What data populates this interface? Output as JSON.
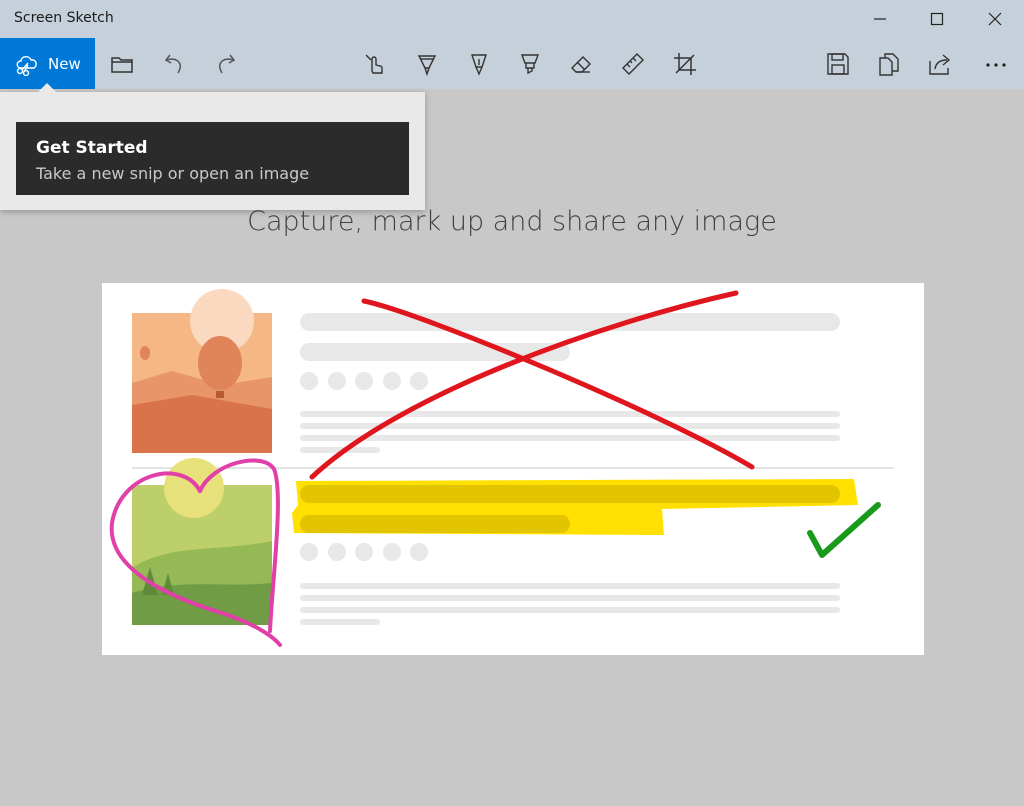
{
  "window": {
    "title": "Screen Sketch",
    "controls": [
      "minimize-icon",
      "maximize-icon",
      "close-icon"
    ]
  },
  "toolbar": {
    "new_label": "New",
    "new_icon": "snip-icon",
    "tools": [
      "open-folder-icon",
      "undo-icon",
      "redo-icon",
      "touch-writing-icon",
      "ballpoint-pen-icon",
      "pencil-icon",
      "highlighter-icon",
      "eraser-icon",
      "ruler-icon",
      "crop-icon",
      "save-icon",
      "copy-icon",
      "share-icon",
      "more-icon"
    ],
    "accent": "#0078d7"
  },
  "flyout": {
    "heading": "Get Started",
    "subtext": "Take a new snip or open an image"
  },
  "main": {
    "headline": "Capture, mark up and share any image"
  },
  "illustration": {
    "annotations": {
      "x_mark_color": "#e0161f",
      "heart_color": "#e040a8",
      "highlight_color": "#ffe000",
      "check_color": "#1a9a1a"
    }
  }
}
